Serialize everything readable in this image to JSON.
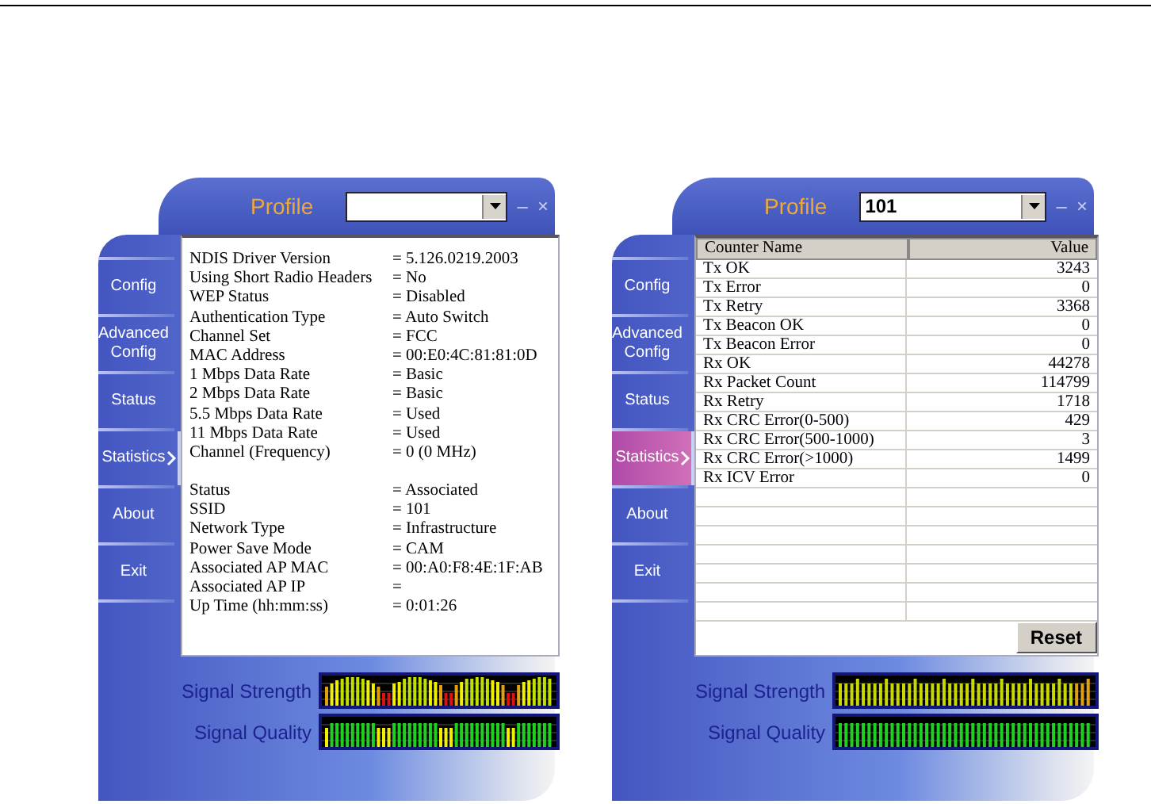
{
  "windows": [
    {
      "profile": {
        "label": "Profile"
      },
      "buttons": {
        "minimize": "–",
        "close": "×"
      },
      "nav": [
        {
          "label": "Config",
          "selected": false,
          "highlighted": false
        },
        {
          "label": "Advanced Config",
          "selected": false,
          "highlighted": false
        },
        {
          "label": "Status",
          "selected": false,
          "highlighted": false
        },
        {
          "label": "Statistics",
          "selected": true,
          "highlighted": false
        },
        {
          "label": "About",
          "selected": false,
          "highlighted": false
        },
        {
          "label": "Exit",
          "selected": false,
          "highlighted": false
        }
      ],
      "content": {
        "kind": "info",
        "groups": [
          [
            {
              "label": "NDIS Driver Version",
              "value": "= 5.126.0219.2003"
            },
            {
              "label": "Using Short Radio Headers",
              "value": "= No"
            },
            {
              "label": "WEP Status",
              "value": "= Disabled"
            },
            {
              "label": "Authentication Type",
              "value": "= Auto Switch"
            },
            {
              "label": "Channel Set",
              "value": "= FCC"
            },
            {
              "label": "MAC Address",
              "value": "= 00:E0:4C:81:81:0D"
            },
            {
              "label": "1 Mbps Data Rate",
              "value": "= Basic"
            },
            {
              "label": "2 Mbps Data Rate",
              "value": "= Basic"
            },
            {
              "label": "5.5 Mbps Data Rate",
              "value": "= Used"
            },
            {
              "label": "11 Mbps Data Rate",
              "value": "= Used"
            },
            {
              "label": "Channel (Frequency)",
              "value": "= 0 (0 MHz)"
            }
          ],
          [
            {
              "label": "Status",
              "value": "= Associated"
            },
            {
              "label": "SSID",
              "value": "= 101"
            },
            {
              "label": "Network Type",
              "value": "= Infrastructure"
            },
            {
              "label": "Power Save Mode",
              "value": "= CAM"
            },
            {
              "label": "Associated AP MAC",
              "value": "= 00:A0:F8:4E:1F:AB"
            },
            {
              "label": "Associated AP IP",
              "value": "="
            },
            {
              "label": "Up Time (hh:mm:ss)",
              "value": "= 0:01:26"
            }
          ]
        ]
      },
      "meters": [
        {
          "label": "Signal Strength",
          "kind": "strength"
        },
        {
          "label": "Signal Quality",
          "kind": "quality"
        }
      ]
    },
    {
      "profile": {
        "label": "Profile",
        "value": "101"
      },
      "buttons": {
        "minimize": "–",
        "close": "×"
      },
      "nav": [
        {
          "label": "Config",
          "selected": false,
          "highlighted": false
        },
        {
          "label": "Advanced Config",
          "selected": false,
          "highlighted": false
        },
        {
          "label": "Status",
          "selected": false,
          "highlighted": false
        },
        {
          "label": "Statistics",
          "selected": true,
          "highlighted": true
        },
        {
          "label": "About",
          "selected": false,
          "highlighted": false
        },
        {
          "label": "Exit",
          "selected": false,
          "highlighted": false
        }
      ],
      "content": {
        "kind": "table",
        "columns": [
          "Counter Name",
          "Value"
        ],
        "rows": [
          [
            "Tx OK",
            "3243"
          ],
          [
            "Tx Error",
            "0"
          ],
          [
            "Tx Retry",
            "3368"
          ],
          [
            "Tx Beacon OK",
            "0"
          ],
          [
            "Tx Beacon Error",
            "0"
          ],
          [
            "Rx OK",
            "44278"
          ],
          [
            "Rx Packet Count",
            "114799"
          ],
          [
            "Rx Retry",
            "1718"
          ],
          [
            "Rx CRC Error(0-500)",
            "429"
          ],
          [
            "Rx CRC Error(500-1000)",
            "3"
          ],
          [
            "Rx CRC Error(>1000)",
            "1499"
          ],
          [
            "Rx ICV Error",
            "0"
          ]
        ],
        "reset": "Reset"
      },
      "meters": [
        {
          "label": "Signal Strength",
          "kind": "strength"
        },
        {
          "label": "Signal Quality",
          "kind": "quality"
        }
      ]
    }
  ]
}
